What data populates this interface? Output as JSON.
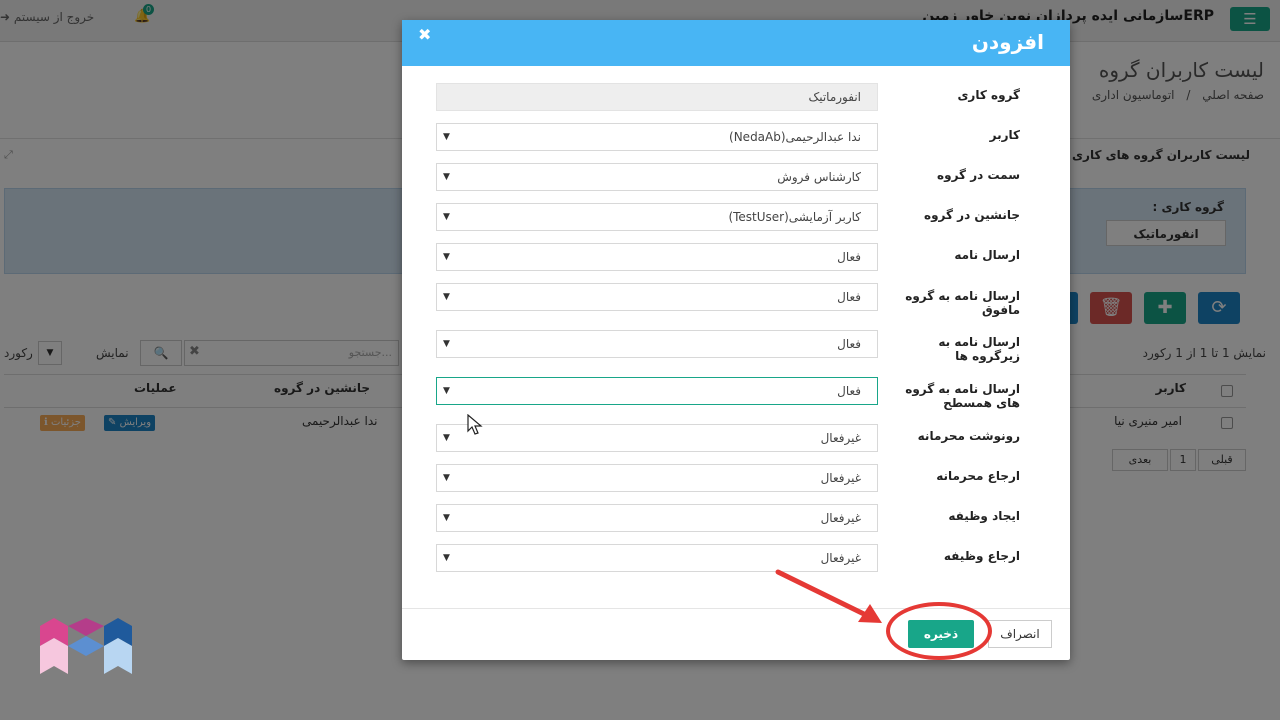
{
  "topbar": {
    "brand": "ERPسازمانی ایده پردازان نوین خاور زمین",
    "notification_count": "0",
    "logout": "خروج از سیستم"
  },
  "page": {
    "title": "لیست کاربران گروه",
    "breadcrumb_home": "صفحه اصلي",
    "breadcrumb_sep": "/",
    "breadcrumb_section": "اتوماسیون اداری"
  },
  "panel": {
    "title": "لیست کاربران گروه های کاری",
    "filter_label": "گروه کاری :",
    "filter_value": "انفورماتیک"
  },
  "table": {
    "show_info": "نمایش 1 تا 1 از 1 رکورد",
    "search_placeholder": "جستجو...",
    "show_label": "نمایش",
    "records_label": "رکورد",
    "col_user": "کاربر",
    "col_substitute": "جانشین در گروه",
    "col_actions": "عملیات",
    "row_user": "امیر منیری نیا",
    "row_substitute": "ندا عبدالرحیمی",
    "edit_label": "ویرایش",
    "details_label": "جزئیات",
    "pager_prev": "قبلی",
    "pager_page": "1",
    "pager_next": "بعدی"
  },
  "modal": {
    "title": "افزودن",
    "close_glyph": "✖",
    "fields": [
      {
        "label": "گروه کاری",
        "value": "انفورماتیک"
      },
      {
        "label": "کاربر",
        "value": "ندا عبدالرحیمی(NedaAb)"
      },
      {
        "label": "سمت در گروه",
        "value": "کارشناس فروش"
      },
      {
        "label": "جانشین در گروه",
        "value": "کاربر آزمایشی(TestUser)"
      },
      {
        "label": "ارسال نامه",
        "value": "فعال"
      },
      {
        "label": "ارسال نامه به گروه مافوق",
        "value": "فعال"
      },
      {
        "label": "ارسال نامه به زیرگروه ها",
        "value": "فعال"
      },
      {
        "label": "ارسال نامه به گروه های همسطح",
        "value": "فعال"
      },
      {
        "label": "رونوشت محرمانه",
        "value": "غیرفعال"
      },
      {
        "label": "ارجاع محرمانه",
        "value": "غیرفعال"
      },
      {
        "label": "ایجاد وظیفه",
        "value": "غیرفعال"
      },
      {
        "label": "ارجاع وظیفه",
        "value": "غیرفعال"
      }
    ],
    "cancel_label": "انصراف",
    "save_label": "ذخیره"
  },
  "colors": {
    "header": "#48b5f4",
    "primary": "#18a689",
    "annotation": "#e53935"
  }
}
